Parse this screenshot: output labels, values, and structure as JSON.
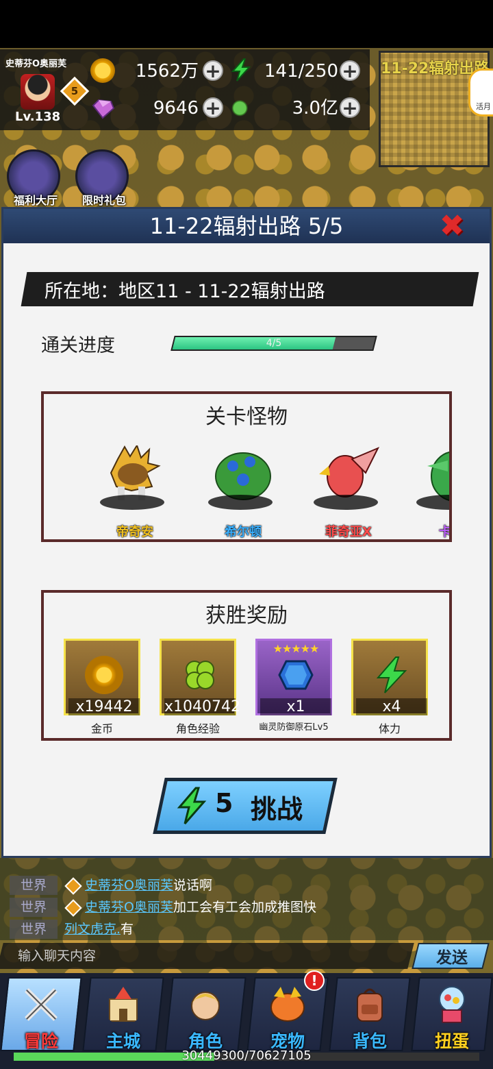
{
  "player": {
    "name": "史蒂芬O奥丽芙",
    "vip": "5",
    "level": "Lv.138"
  },
  "resources": {
    "gold": "1562万",
    "stamina": "141/250",
    "gems": "9646",
    "candy": "3.0亿"
  },
  "minimap": {
    "title": "11-22辐射出路",
    "side_label": "活月"
  },
  "shortcuts": [
    {
      "label": "福利大厅",
      "icon": "gift-bouquet-icon"
    },
    {
      "label": "限时礼包",
      "icon": "treasure-chest-icon"
    }
  ],
  "dialog": {
    "title": "11-22辐射出路  5/5",
    "location": "所在地：地区11 - 11-22辐射出路",
    "progress_label": "通关进度",
    "progress_text": "4/5",
    "progress_fraction": 0.8,
    "monsters_title": "关卡怪物",
    "monsters": [
      {
        "name": "帝奇安",
        "color": "#f0c020",
        "icon": "lion-monster-icon"
      },
      {
        "name": "希尔顿",
        "color": "#3ab0ff",
        "icon": "green-beast-icon"
      },
      {
        "name": "菲奇亚X",
        "color": "#ff4a4a",
        "icon": "red-bird-icon"
      },
      {
        "name": "卡克",
        "color": "#c060ff",
        "icon": "crocodile-icon"
      }
    ],
    "rewards_title": "获胜奖励",
    "rewards": [
      {
        "qty": "x19442",
        "name": "金币",
        "icon": "coin-icon"
      },
      {
        "qty": "x1040742",
        "name": "角色经验",
        "icon": "clover-icon"
      },
      {
        "qty": "x1",
        "name": "幽灵防御原石Lv5",
        "icon": "blue-gem-icon",
        "stars": "★★★★★"
      },
      {
        "qty": "x4",
        "name": "体力",
        "icon": "lightning-icon"
      }
    ],
    "challenge_cost": "5",
    "challenge_label": "挑战"
  },
  "chat": {
    "lines": [
      {
        "channel": "世界",
        "user": "史蒂芬O奥丽芙",
        "message": "说话啊",
        "vip": true
      },
      {
        "channel": "世界",
        "user": "史蒂芬O奥丽芙",
        "message": "加工会有工会加成推图快",
        "vip": true
      },
      {
        "channel": "世界",
        "user": "列文虎克.",
        "message": "有",
        "vip": false
      }
    ],
    "input_placeholder": "输入聊天内容",
    "send_label": "发送"
  },
  "nav": [
    {
      "label": "冒险",
      "color": "#ff3a3a",
      "icon": "crossed-swords-icon",
      "active": true
    },
    {
      "label": "主城",
      "color": "#3ab8ff",
      "icon": "castle-icon",
      "active": false
    },
    {
      "label": "角色",
      "color": "#3ab8ff",
      "icon": "hero-face-icon",
      "active": false
    },
    {
      "label": "宠物",
      "color": "#3ab8ff",
      "icon": "pet-dragon-icon",
      "active": false
    },
    {
      "label": "背包",
      "color": "#3ab8ff",
      "icon": "backpack-icon",
      "active": false
    },
    {
      "label": "扭蛋",
      "color": "#ffd020",
      "icon": "gacha-machine-icon",
      "active": false
    }
  ],
  "exp": {
    "text": "30449300/70627105",
    "fraction": 0.431
  }
}
